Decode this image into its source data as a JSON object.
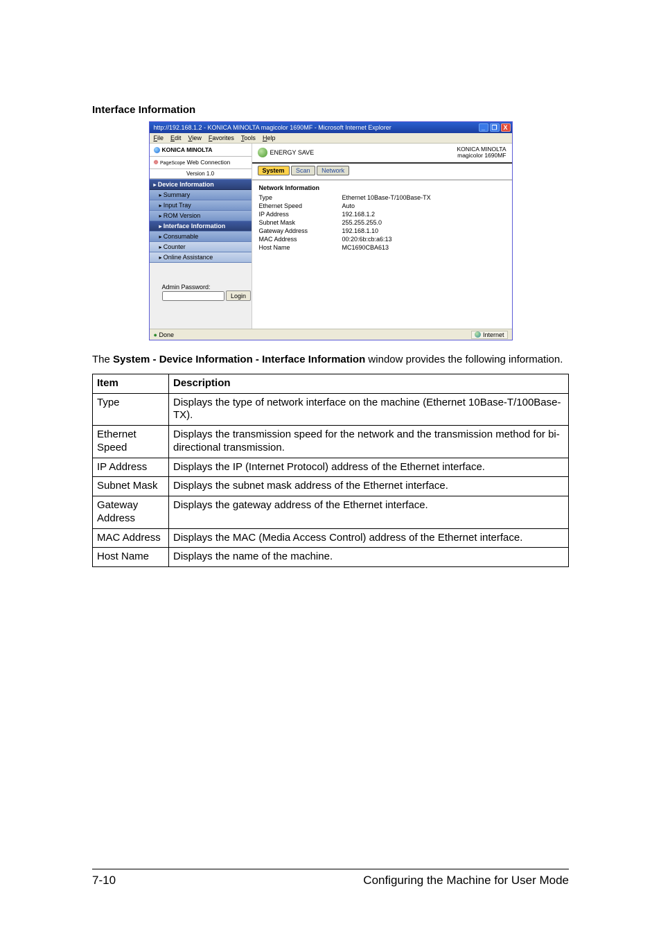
{
  "section_title": "Interface Information",
  "browser": {
    "titlebar": "http://192.168.1.2 - KONICA MINOLTA magicolor 1690MF - Microsoft Internet Explorer",
    "menu": [
      "File",
      "Edit",
      "View",
      "Favorites",
      "Tools",
      "Help"
    ],
    "statusbar": {
      "done": "Done",
      "zone": "Internet"
    },
    "winbuttons": {
      "min": "_",
      "max": "❐",
      "close": "X"
    }
  },
  "branding": {
    "vendor": "KONICA MINOLTA",
    "wc_prefix": "PageScope",
    "wc_label": "Web Connection",
    "version": "Version 1.0"
  },
  "topstrip": {
    "energy": "ENERGY SAVE",
    "right1": "KONICA MINOLTA",
    "right2": "magicolor 1690MF"
  },
  "tabs": {
    "system": "System",
    "scan": "Scan",
    "network": "Network"
  },
  "sidebar": {
    "device_info": "Device Information",
    "summary": "Summary",
    "input_tray": "Input Tray",
    "rom_version": "ROM Version",
    "interface_information": "Interface Information",
    "consumable": "Consumable",
    "counter": "Counter",
    "online_assistance": "Online Assistance"
  },
  "main": {
    "heading": "Network Information",
    "rows": {
      "type": {
        "label": "Type",
        "value": "Ethernet 10Base-T/100Base-TX"
      },
      "eth_speed": {
        "label": "Ethernet Speed",
        "value": "Auto"
      },
      "ip": {
        "label": "IP Address",
        "value": "192.168.1.2"
      },
      "subnet": {
        "label": "Subnet Mask",
        "value": "255.255.255.0"
      },
      "gateway": {
        "label": "Gateway Address",
        "value": "192.168.1.10"
      },
      "mac": {
        "label": "MAC Address",
        "value": "00:20:6b:cb:a6:13"
      },
      "host": {
        "label": "Host Name",
        "value": "MC1690CBA613"
      }
    },
    "admin_label": "Admin Password:",
    "login": "Login"
  },
  "desc": {
    "prefix": "The ",
    "bold": "System - Device Information - Interface Information",
    "suffix": " window provides the following information."
  },
  "table": {
    "head_item": "Item",
    "head_desc": "Description",
    "rows": [
      {
        "item": "Type",
        "desc": "Displays the type of network interface on the machine (Ethernet 10Base-T/100Base-TX)."
      },
      {
        "item": "Ethernet Speed",
        "desc": "Displays the transmission speed for the network and the transmission method for bi-directional transmission."
      },
      {
        "item": "IP Address",
        "desc": "Displays the IP (Internet Protocol) address of the Ethernet interface."
      },
      {
        "item": "Subnet Mask",
        "desc": "Displays the subnet mask address of the Ethernet interface."
      },
      {
        "item": "Gateway Address",
        "desc": "Displays the gateway address of the Ethernet interface."
      },
      {
        "item": "MAC Address",
        "desc": "Displays the MAC (Media Access Control) address of the Ethernet interface."
      },
      {
        "item": "Host Name",
        "desc": "Displays the name of the machine."
      }
    ]
  },
  "footer": {
    "page": "7-10",
    "chapter": "Configuring the Machine for User Mode"
  }
}
